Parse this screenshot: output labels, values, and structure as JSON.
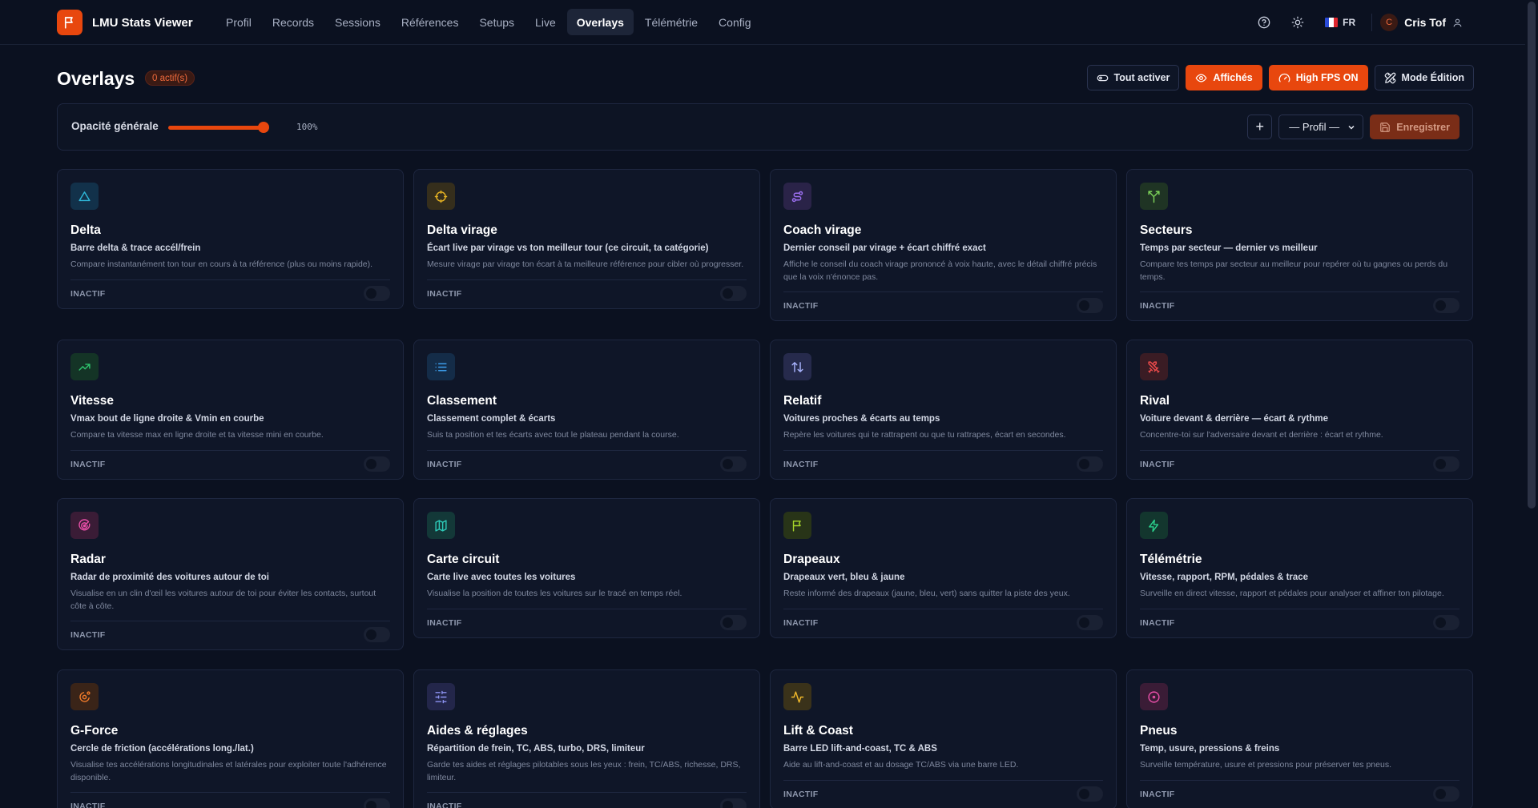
{
  "app": {
    "title": "LMU Stats Viewer",
    "logo_icon": "flag-icon"
  },
  "nav": [
    {
      "label": "Profil",
      "active": false
    },
    {
      "label": "Records",
      "active": false
    },
    {
      "label": "Sessions",
      "active": false
    },
    {
      "label": "Références",
      "active": false
    },
    {
      "label": "Setups",
      "active": false
    },
    {
      "label": "Live",
      "active": false
    },
    {
      "label": "Overlays",
      "active": true
    },
    {
      "label": "Télémétrie",
      "active": false
    },
    {
      "label": "Config",
      "active": false
    }
  ],
  "topbar": {
    "help_icon": "help-circle-icon",
    "theme_icon": "sun-icon",
    "lang": "FR",
    "avatar_letter": "C",
    "user_name": "Cris Tof",
    "user_icon": "user-icon"
  },
  "page": {
    "title": "Overlays",
    "active_badge": "0 actif(s)"
  },
  "actions": {
    "all_on": "Tout activer",
    "shown": "Affichés",
    "high_fps": "High FPS ON",
    "edit_mode": "Mode Édition"
  },
  "opacity": {
    "label": "Opacité générale",
    "value_text": "100%",
    "value": 1.0,
    "add_label": "+",
    "profile_select": "— Profil —",
    "save_label": "Enregistrer"
  },
  "colors": {
    "accent": "#e8470e",
    "bg": "#0b1120",
    "card": "#0f1628"
  },
  "cards": [
    {
      "title": "Delta",
      "subtitle": "Barre delta & trace accél/frein",
      "description": "Compare instantanément ton tour en cours à ta référence (plus ou moins rapide).",
      "status": "INACTIF",
      "icon": "triangle-icon",
      "color": "#2fb7d9",
      "bg": "#12314a"
    },
    {
      "title": "Delta virage",
      "subtitle": "Écart live par virage vs ton meilleur tour (ce circuit, ta catégorie)",
      "description": "Mesure virage par virage ton écart à ta meilleure référence pour cibler où progresser.",
      "status": "INACTIF",
      "icon": "crosshair-icon",
      "color": "#e6b323",
      "bg": "#352e1c"
    },
    {
      "title": "Coach virage",
      "subtitle": "Dernier conseil par virage + écart chiffré exact",
      "description": "Affiche le conseil du coach virage prononcé à voix haute, avec le détail chiffré précis que la voix n'énonce pas.",
      "status": "INACTIF",
      "icon": "route-icon",
      "color": "#9b6ff0",
      "bg": "#2a2348"
    },
    {
      "title": "Secteurs",
      "subtitle": "Temps par secteur — dernier vs meilleur",
      "description": "Compare tes temps par secteur au meilleur pour repérer où tu gagnes ou perds du temps.",
      "status": "INACTIF",
      "icon": "split-icon",
      "color": "#7dd35a",
      "bg": "#1f3424"
    },
    {
      "title": "Vitesse",
      "subtitle": "Vmax bout de ligne droite & Vmin en courbe",
      "description": "Compare ta vitesse max en ligne droite et ta vitesse mini en courbe.",
      "status": "INACTIF",
      "icon": "trending-up-icon",
      "color": "#2fc46e",
      "bg": "#143426"
    },
    {
      "title": "Classement",
      "subtitle": "Classement complet & écarts",
      "description": "Suis ta position et tes écarts avec tout le plateau pendant la course.",
      "status": "INACTIF",
      "icon": "list-icon",
      "color": "#3b9be8",
      "bg": "#142c48"
    },
    {
      "title": "Relatif",
      "subtitle": "Voitures proches & écarts au temps",
      "description": "Repère les voitures qui te rattrapent ou que tu rattrapes, écart en secondes.",
      "status": "INACTIF",
      "icon": "arrows-up-down-icon",
      "color": "#aab4ff",
      "bg": "#262a4c"
    },
    {
      "title": "Rival",
      "subtitle": "Voiture devant & derrière — écart & rythme",
      "description": "Concentre-toi sur l'adversaire devant et derrière : écart et rythme.",
      "status": "INACTIF",
      "icon": "swords-icon",
      "color": "#ef4b4b",
      "bg": "#3a1c24"
    },
    {
      "title": "Radar",
      "subtitle": "Radar de proximité des voitures autour de toi",
      "description": "Visualise en un clin d'œil les voitures autour de toi pour éviter les contacts, surtout côte à côte.",
      "status": "INACTIF",
      "icon": "radar-icon",
      "color": "#e84fa8",
      "bg": "#3a1c36"
    },
    {
      "title": "Carte circuit",
      "subtitle": "Carte live avec toutes les voitures",
      "description": "Visualise la position de toutes les voitures sur le tracé en temps réel.",
      "status": "INACTIF",
      "icon": "map-icon",
      "color": "#2dc9b8",
      "bg": "#133838"
    },
    {
      "title": "Drapeaux",
      "subtitle": "Drapeaux vert, bleu & jaune",
      "description": "Reste informé des drapeaux (jaune, bleu, vert) sans quitter la piste des yeux.",
      "status": "INACTIF",
      "icon": "flag-icon",
      "color": "#a6d62a",
      "bg": "#283418"
    },
    {
      "title": "Télémétrie",
      "subtitle": "Vitesse, rapport, RPM, pédales & trace",
      "description": "Surveille en direct vitesse, rapport et pédales pour analyser et affiner ton pilotage.",
      "status": "INACTIF",
      "icon": "zap-icon",
      "color": "#2bd18d",
      "bg": "#13362e"
    },
    {
      "title": "G-Force",
      "subtitle": "Cercle de friction (accélérations long./lat.)",
      "description": "Visualise tes accélérations longitudinales et latérales pour exploiter toute l'adhérence disponible.",
      "status": "INACTIF",
      "icon": "orbit-icon",
      "color": "#ef7a2a",
      "bg": "#3a2418"
    },
    {
      "title": "Aides & réglages",
      "subtitle": "Répartition de frein, TC, ABS, turbo, DRS, limiteur",
      "description": "Garde tes aides et réglages pilotables sous les yeux : frein, TC/ABS, richesse, DRS, limiteur.",
      "status": "INACTIF",
      "icon": "sliders-icon",
      "color": "#8d93f2",
      "bg": "#23264a"
    },
    {
      "title": "Lift & Coast",
      "subtitle": "Barre LED lift-and-coast, TC & ABS",
      "description": "Aide au lift-and-coast et au dosage TC/ABS via une barre LED.",
      "status": "INACTIF",
      "icon": "activity-icon",
      "color": "#f2b92a",
      "bg": "#3a321a"
    },
    {
      "title": "Pneus",
      "subtitle": "Temp, usure, pressions & freins",
      "description": "Surveille température, usure et pressions pour préserver tes pneus.",
      "status": "INACTIF",
      "icon": "circle-dot-icon",
      "color": "#e84fa8",
      "bg": "#3a1c36"
    }
  ]
}
